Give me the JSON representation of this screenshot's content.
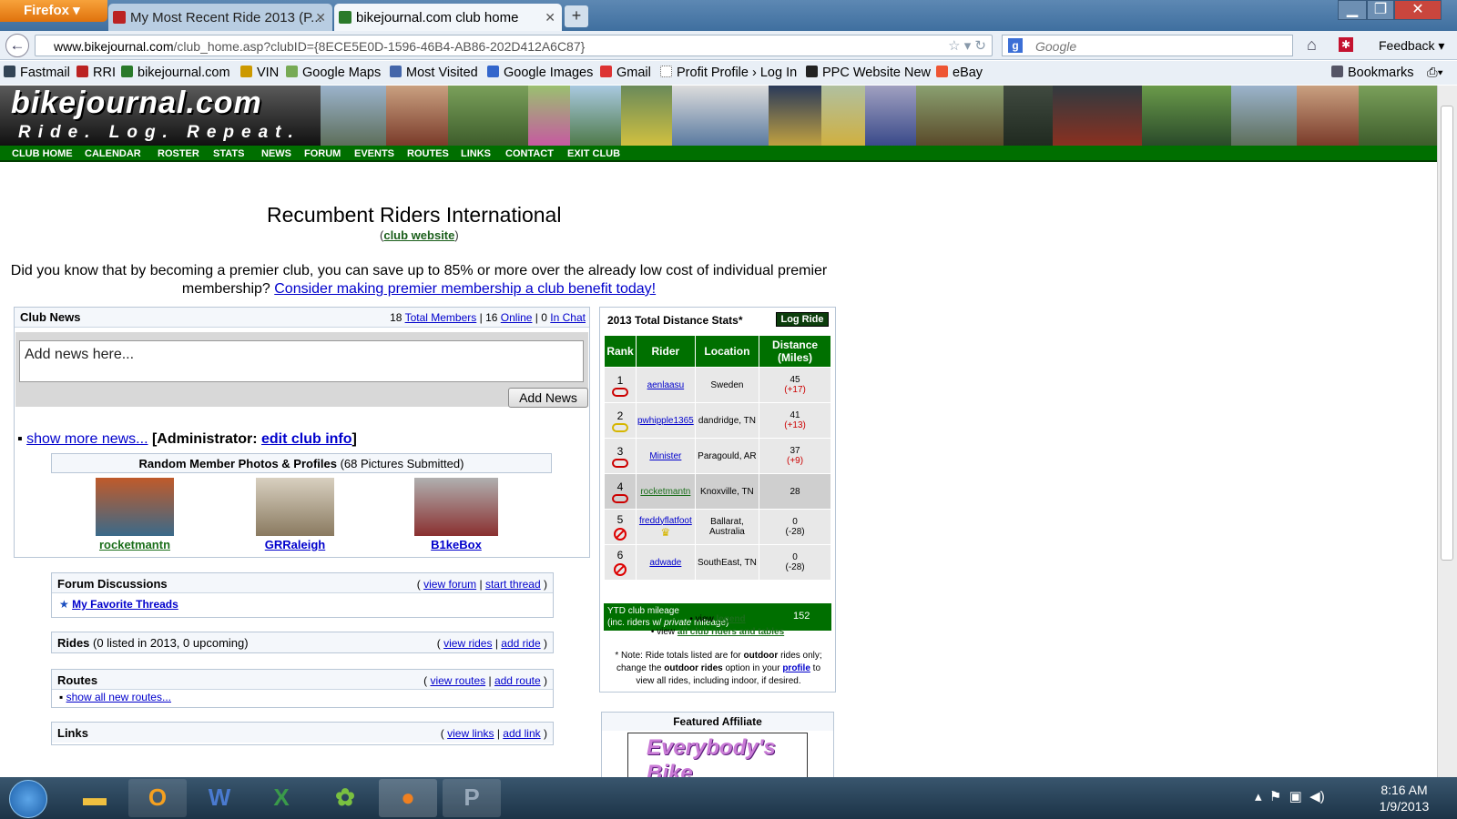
{
  "browser": {
    "menu_label": "Firefox",
    "tabs": [
      {
        "title": "My Most Recent Ride 2013 (P..."
      },
      {
        "title": "bikejournal.com club home"
      }
    ],
    "url_domain": "www.bikejournal.com",
    "url_path": "/club_home.asp?clubID={8ECE5E0D-1596-46B4-AB86-202D412A6C87}",
    "search_placeholder": "Google",
    "feedback_label": "Feedback",
    "bookmarks_label": "Bookmarks",
    "bookmarks": [
      "Fastmail",
      "RRI",
      "bikejournal.com",
      "VIN",
      "Google Maps",
      "Most Visited",
      "Google Images",
      "Gmail",
      "Profit Profile › Log In",
      "PPC Website New",
      "eBay"
    ]
  },
  "site": {
    "logo": "bikejournal.com",
    "tagline": "Ride. Log. Repeat.",
    "colors": {
      "nav_green": "#006f00"
    },
    "nav": [
      "CLUB HOME",
      "CALENDAR",
      "ROSTER",
      "STATS",
      "NEWS",
      "FORUM",
      "EVENTS",
      "ROUTES",
      "LINKS",
      "CONTACT",
      "EXIT CLUB"
    ]
  },
  "club": {
    "name": "Recumbent Riders International",
    "website_open": "(",
    "website_link": "club website",
    "website_close": ")",
    "promo_text": "Did you know that by becoming a premier club, you can save up to 85% or more over the already low cost of individual premier membership?",
    "promo_link": "Consider making premier membership a club benefit today!"
  },
  "news": {
    "header": "Club News",
    "members_count": "18",
    "members_label": "Total Members",
    "online_count": "16",
    "online_label": "Online",
    "chat_count": "0",
    "chat_label": "In Chat",
    "placeholder": "Add news here...",
    "button": "Add News",
    "more_news": "show more news...",
    "admin_label": "[Administrator:",
    "admin_link": "edit club info",
    "admin_close": "]"
  },
  "photos": {
    "title": "Random Member Photos & Profiles",
    "count_note": "(68 Pictures Submitted)",
    "members": [
      "rocketmantn",
      "GRRaleigh",
      "B1keBox"
    ]
  },
  "forum": {
    "title": "Forum Discussions",
    "view": "view forum",
    "start": "start thread",
    "fav": "My Favorite Threads"
  },
  "rides": {
    "title": "Rides",
    "note": "(0 listed in 2013, 0 upcoming)",
    "view": "view rides",
    "add": "add ride"
  },
  "routes": {
    "title": "Routes",
    "view": "view routes",
    "add": "add route",
    "show": "show all new routes..."
  },
  "links": {
    "title": "Links",
    "view": "view links",
    "add": "add link"
  },
  "stats": {
    "title": "2013 Total Distance Stats*",
    "log_ride": "Log Ride",
    "headers": [
      "Rank",
      "Rider",
      "Location",
      "Distance (Miles)"
    ],
    "rows": [
      {
        "rank": "1",
        "rider": "aenlaasu",
        "location": "Sweden",
        "distance": "45",
        "delta": "(+17)"
      },
      {
        "rank": "2",
        "rider": "pwhipple1365",
        "location": "dandridge, TN",
        "distance": "41",
        "delta": "(+13)"
      },
      {
        "rank": "3",
        "rider": "Minister",
        "location": "Paragould, AR",
        "distance": "37",
        "delta": "(+9)"
      },
      {
        "rank": "4",
        "rider": "rocketmantn",
        "location": "Knoxville, TN",
        "distance": "28",
        "delta": ""
      },
      {
        "rank": "5",
        "rider": "freddyflatfoot",
        "location": "Ballarat, Australia",
        "distance": "0",
        "delta": "(-28)"
      },
      {
        "rank": "6",
        "rider": "adwade",
        "location": "SouthEast, TN",
        "distance": "0",
        "delta": "(-28)"
      }
    ],
    "ytd_label1": "YTD club mileage",
    "ytd_label2a": "(inc. riders w/",
    "ytd_label2b": "private",
    "ytd_label2c": "mileage)",
    "ytd_value": "152",
    "legend_pre": "view",
    "legend_link": "legend",
    "tables_pre": "view",
    "tables_link": "all club riders and tables",
    "note_a": "* Note: Ride totals listed are for",
    "note_b": "outdoor",
    "note_c": "rides only; change the",
    "note_d": "outdoor rides",
    "note_e": "option in your",
    "note_f": "profile",
    "note_g": "to view all rides, including indoor, if desired."
  },
  "affiliate": {
    "title": "Featured Affiliate",
    "logo_text": "Everybody's Bike"
  },
  "taskbar": {
    "time": "8:16 AM",
    "date": "1/9/2013"
  }
}
